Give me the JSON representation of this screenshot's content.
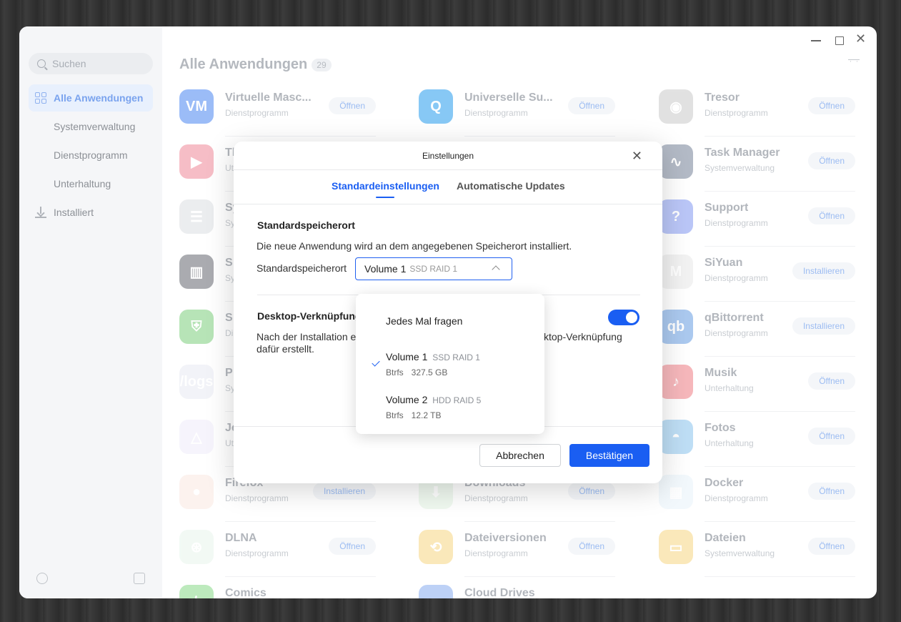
{
  "sidebar": {
    "search_placeholder": "Suchen",
    "items": [
      {
        "label": "Alle Anwendungen"
      },
      {
        "label": "Systemverwaltung"
      },
      {
        "label": "Dienstprogramm"
      },
      {
        "label": "Unterhaltung"
      },
      {
        "label": "Installiert"
      }
    ]
  },
  "main": {
    "title": "Alle Anwendungen",
    "count": "29"
  },
  "apps": [
    {
      "name": "Virtuelle Masc...",
      "category": "Dienstprogramm",
      "action": "Öffnen",
      "color": "#7aa6f5",
      "icon": "VM"
    },
    {
      "name": "Universelle Su...",
      "category": "Dienstprogramm",
      "action": "Öffnen",
      "color": "#5fb6f2",
      "icon": "Q"
    },
    {
      "name": "Tresor",
      "category": "Dienstprogramm",
      "action": "Öffnen",
      "color": "#d8d8d8",
      "icon": "◉"
    },
    {
      "name": "Th",
      "category": "Ut",
      "action": "",
      "color": "#f4a8b4",
      "icon": "▶"
    },
    {
      "name": "",
      "category": "",
      "action": "",
      "color": "",
      "icon": ""
    },
    {
      "name": "Task Manager",
      "category": "Systemverwaltung",
      "action": "Öffnen",
      "color": "#9aa3b3",
      "icon": "∿"
    },
    {
      "name": "Sy",
      "category": "Sy",
      "action": "",
      "color": "#e5e7ea",
      "icon": "☰"
    },
    {
      "name": "",
      "category": "",
      "action": "",
      "color": "",
      "icon": ""
    },
    {
      "name": "Support",
      "category": "Dienstprogramm",
      "action": "Öffnen",
      "color": "#a3b4f5",
      "icon": "?"
    },
    {
      "name": "S",
      "category": "Sy",
      "action": "",
      "color": "#8e9096",
      "icon": "▥"
    },
    {
      "name": "",
      "category": "",
      "action": "",
      "color": "",
      "icon": ""
    },
    {
      "name": "SiYuan",
      "category": "Dienstprogramm",
      "action": "Installieren",
      "color": "#eeeeee",
      "icon": "M"
    },
    {
      "name": "S",
      "category": "Di",
      "action": "",
      "color": "#9fdc9f",
      "icon": "⛨"
    },
    {
      "name": "",
      "category": "",
      "action": "",
      "color": "",
      "icon": ""
    },
    {
      "name": "qBittorrent",
      "category": "Dienstprogramm",
      "action": "Installieren",
      "color": "#8fb7ea",
      "icon": "qb"
    },
    {
      "name": "P",
      "category": "Sy",
      "action": "",
      "color": "#eef0f6",
      "icon": "/logs"
    },
    {
      "name": "",
      "category": "",
      "action": "",
      "color": "",
      "icon": ""
    },
    {
      "name": "Musik",
      "category": "Unterhaltung",
      "action": "Öffnen",
      "color": "#f3a0a5",
      "icon": "♪"
    },
    {
      "name": "Je",
      "category": "Ut",
      "action": "",
      "color": "#f3f1fb",
      "icon": "△"
    },
    {
      "name": "",
      "category": "",
      "action": "",
      "color": "",
      "icon": ""
    },
    {
      "name": "Fotos",
      "category": "Unterhaltung",
      "action": "Öffnen",
      "color": "#a9d3f2",
      "icon": "◓"
    },
    {
      "name": "Firefox",
      "category": "Dienstprogramm",
      "action": "Installieren",
      "color": "#fbeee9",
      "icon": "●"
    },
    {
      "name": "Downloads",
      "category": "Dienstprogramm",
      "action": "Öffnen",
      "color": "#eaf6ea",
      "icon": "⬇"
    },
    {
      "name": "Docker",
      "category": "Dienstprogramm",
      "action": "Öffnen",
      "color": "#eef6fc",
      "icon": "▦"
    },
    {
      "name": "DLNA",
      "category": "Dienstprogramm",
      "action": "Öffnen",
      "color": "#eef8f1",
      "icon": "⊛"
    },
    {
      "name": "Dateiversionen",
      "category": "Dienstprogramm",
      "action": "Öffnen",
      "color": "#f9e1a4",
      "icon": "⟲"
    },
    {
      "name": "Dateien",
      "category": "Systemverwaltung",
      "action": "Öffnen",
      "color": "#f9e1a4",
      "icon": "▭"
    },
    {
      "name": "Comics",
      "category": "",
      "action": "",
      "color": "#a8e3a8",
      "icon": "⌇"
    },
    {
      "name": "Cloud Drives",
      "category": "",
      "action": "",
      "color": "#a7c2f4",
      "icon": "☁"
    }
  ],
  "dialog": {
    "title": "Einstellungen",
    "tabs": [
      "Standardeinstellungen",
      "Automatische Updates"
    ],
    "storage": {
      "heading": "Standardspeicherort",
      "description": "Die neue Anwendung wird an dem angegebenen Speicherort installiert.",
      "label": "Standardspeicherort",
      "selected_volume": "Volume 1",
      "selected_raid": "SSD RAID 1"
    },
    "shortcut": {
      "heading": "Desktop-Verknüpfung",
      "description_line1": "Nach der Installation e",
      "description_line1_end": "ktop-Verknüpfung",
      "description_line2": "dafür erstellt.",
      "enabled": true
    },
    "cancel_label": "Abbrechen",
    "confirm_label": "Bestätigen"
  },
  "dropdown": {
    "options": [
      {
        "label": "Jedes Mal fragen"
      },
      {
        "label": "Volume 1",
        "raid": "SSD RAID 1",
        "fs": "Btrfs",
        "size": "327.5 GB",
        "selected": true
      },
      {
        "label": "Volume 2",
        "raid": "HDD RAID 5",
        "fs": "Btrfs",
        "size": "12.2 TB"
      }
    ]
  },
  "colors": {
    "accent": "#1a5ef2"
  }
}
